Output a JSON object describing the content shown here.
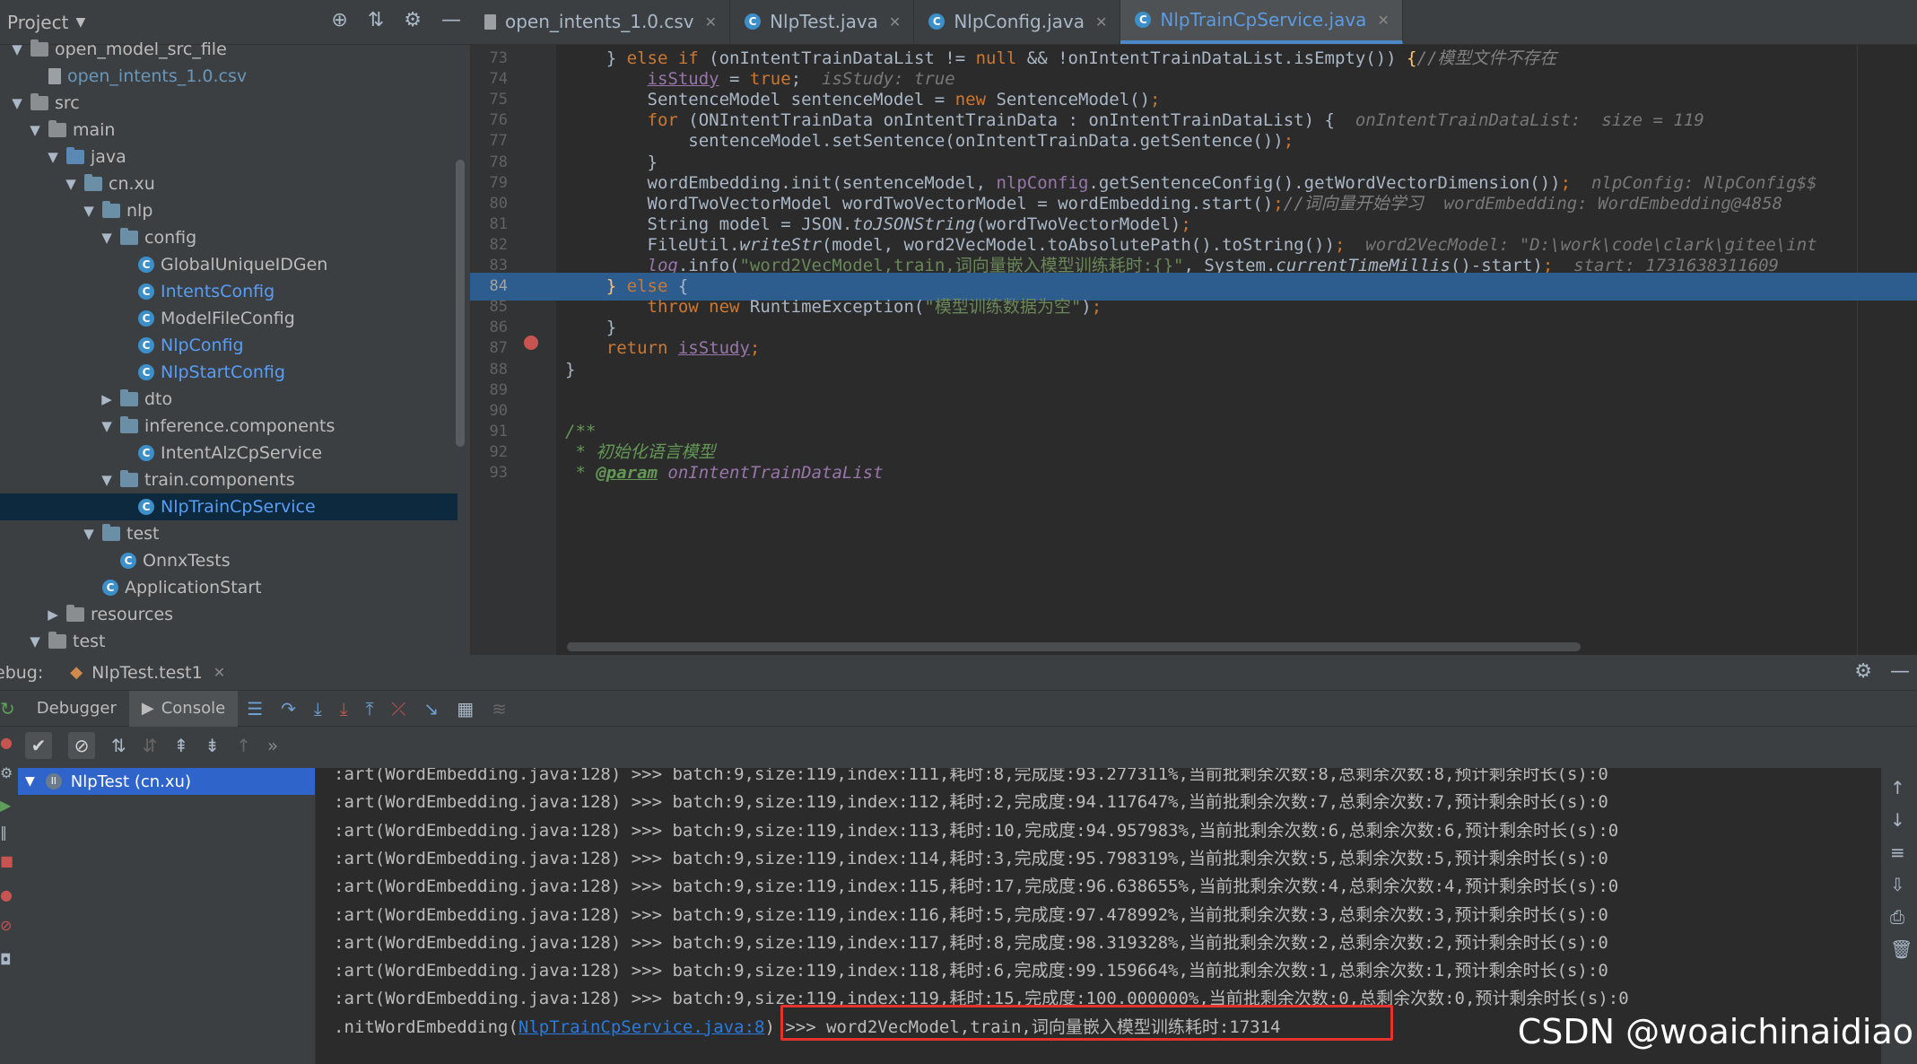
{
  "project": {
    "title": "Project",
    "tree": [
      {
        "label": "open_model_src_file",
        "depth": 0,
        "arrow": "▼",
        "icon": "folder",
        "color": "white"
      },
      {
        "label": "open_intents_1.0.csv",
        "depth": 1,
        "arrow": "",
        "icon": "file",
        "color": "blue"
      },
      {
        "label": "src",
        "depth": 0,
        "arrow": "▼",
        "icon": "folder",
        "color": "white"
      },
      {
        "label": "main",
        "depth": 1,
        "arrow": "▼",
        "icon": "folder",
        "color": "white"
      },
      {
        "label": "java",
        "depth": 2,
        "arrow": "▼",
        "icon": "src",
        "color": "white"
      },
      {
        "label": "cn.xu",
        "depth": 3,
        "arrow": "▼",
        "icon": "pkg",
        "color": "white"
      },
      {
        "label": "nlp",
        "depth": 4,
        "arrow": "▼",
        "icon": "pkg",
        "color": "white"
      },
      {
        "label": "config",
        "depth": 5,
        "arrow": "▼",
        "icon": "pkg",
        "color": "white"
      },
      {
        "label": "GlobalUniqueIDGen",
        "depth": 6,
        "arrow": "",
        "icon": "class",
        "color": "white"
      },
      {
        "label": "IntentsConfig",
        "depth": 6,
        "arrow": "",
        "icon": "class",
        "color": "link"
      },
      {
        "label": "ModelFileConfig",
        "depth": 6,
        "arrow": "",
        "icon": "class",
        "color": "white"
      },
      {
        "label": "NlpConfig",
        "depth": 6,
        "arrow": "",
        "icon": "class",
        "color": "link"
      },
      {
        "label": "NlpStartConfig",
        "depth": 6,
        "arrow": "",
        "icon": "class",
        "color": "link"
      },
      {
        "label": "dto",
        "depth": 5,
        "arrow": "▶",
        "icon": "pkg",
        "color": "white"
      },
      {
        "label": "inference.components",
        "depth": 5,
        "arrow": "▼",
        "icon": "pkg",
        "color": "white"
      },
      {
        "label": "IntentAlzCpService",
        "depth": 6,
        "arrow": "",
        "icon": "class",
        "color": "white"
      },
      {
        "label": "train.components",
        "depth": 5,
        "arrow": "▼",
        "icon": "pkg",
        "color": "white"
      },
      {
        "label": "NlpTrainCpService",
        "depth": 6,
        "arrow": "",
        "icon": "class",
        "color": "link",
        "selected": true
      },
      {
        "label": "test",
        "depth": 4,
        "arrow": "▼",
        "icon": "pkg",
        "color": "white"
      },
      {
        "label": "OnnxTests",
        "depth": 5,
        "arrow": "",
        "icon": "class",
        "color": "white"
      },
      {
        "label": "ApplicationStart",
        "depth": 4,
        "arrow": "",
        "icon": "class",
        "color": "white"
      },
      {
        "label": "resources",
        "depth": 2,
        "arrow": "▶",
        "icon": "folder",
        "color": "white"
      },
      {
        "label": "test",
        "depth": 1,
        "arrow": "▼",
        "icon": "folder",
        "color": "white"
      }
    ]
  },
  "tabs": [
    {
      "label": "open_intents_1.0.csv",
      "icon": "file",
      "active": false
    },
    {
      "label": "NlpTest.java",
      "icon": "class",
      "active": false
    },
    {
      "label": "NlpConfig.java",
      "icon": "class",
      "active": false
    },
    {
      "label": "NlpTrainCpService.java",
      "icon": "class",
      "active": true
    }
  ],
  "code_lines": [
    {
      "n": "73",
      "html": "    <span class='plain'>} </span><span class='k'>else if </span><span class='plain'>(onIntentTrainDataList != </span><span class='k'>null </span><span class='plain'>&amp;&amp; !onIntentTrainDataList.isEmpty()) </span><span class='fn'>{</span><span class='c'>//模型文件不存在</span>"
    },
    {
      "n": "74",
      "html": "        <span class='pf'><u>isStudy</u></span><span class='plain'> = </span><span class='k'>true</span><span class='plain'>;  </span><span class='hint'>isStudy: true</span>"
    },
    {
      "n": "75",
      "html": "        <span class='plain'>SentenceModel sentenceModel = </span><span class='k'>new </span><span class='plain'>SentenceModel()</span><span class='k'>;</span>"
    },
    {
      "n": "76",
      "html": "        <span class='k'>for </span><span class='plain'>(ONIntentTrainData onIntentTrainData : onIntentTrainDataList) {  </span><span class='hint'>onIntentTrainDataList:  size = 119</span>"
    },
    {
      "n": "77",
      "html": "            <span class='plain'>sentenceModel.setSentence(onIntentTrainData.getSentence())</span><span class='k'>;</span>"
    },
    {
      "n": "78",
      "html": "        <span class='plain'>}</span>"
    },
    {
      "n": "79",
      "html": "        <span class='plain'>wordEmbedding.init(sentenceModel, </span><span class='pf'>nlpConfig</span><span class='plain'>.getSentenceConfig().getWordVectorDimension())</span><span class='k'>;  </span><span class='hint'>nlpConfig: NlpConfig$$</span>"
    },
    {
      "n": "80",
      "html": "        <span class='plain'>WordTwoVectorModel wordTwoVectorModel = wordEmbedding.start()</span><span class='k'>;</span><span class='c'>//词向量开始学习  </span><span class='hint'>wordEmbedding: WordEmbedding@4858</span>"
    },
    {
      "n": "81",
      "html": "        <span class='plain'>String model = JSON.</span><span class='plain'><i>toJSONString</i></span><span class='plain'>(wordTwoVectorModel)</span><span class='k'>;</span>"
    },
    {
      "n": "82",
      "html": "        <span class='plain'>FileUtil.</span><span class='plain'><i>writeStr</i></span><span class='plain'>(model, word2VecModel.toAbsolutePath().toString())</span><span class='k'>;  </span><span class='hint'>word2VecModel: \"D:\\work\\code\\clark\\gitee\\int</span>"
    },
    {
      "n": "83",
      "html": "        <span class='pf'><i>log</i></span><span class='plain'>.info(</span><span class='s'>\"word2VecModel,train,词向量嵌入模型训练耗时:{}\"</span><span class='plain'>, System.</span><span class='plain'><i>currentTimeMillis</i></span><span class='plain'>()-start)</span><span class='k'>;  </span><span class='hint'>start: 1731638311609</span>"
    },
    {
      "n": "84",
      "html": "    <span class='fn'>}</span><span class='k'> else </span><span class='plain'>{</span>"
    },
    {
      "n": "85",
      "html": "        <span class='k'>throw new </span><span class='plain'>RuntimeException(</span><span class='s'>\"模型训练数据为空\"</span><span class='plain'>)</span><span class='k'>;</span>"
    },
    {
      "n": "86",
      "html": "    <span class='plain'>}</span>"
    },
    {
      "n": "87",
      "html": "    <span class='k'>return </span><span class='pf'><u>isStudy</u></span><span class='k'>;</span>"
    },
    {
      "n": "88",
      "html": "<span class='plain'>}</span>"
    },
    {
      "n": "89",
      "html": ""
    },
    {
      "n": "90",
      "html": ""
    },
    {
      "n": "91",
      "html": "<span class='doc'>/**</span>"
    },
    {
      "n": "92",
      "html": " <span class='doc'>* 初始化语言模型</span>"
    },
    {
      "n": "93",
      "html": " <span class='doc'>* </span><span class='doc'><b><u>@param</u></b></span><span class='pf'><i> onIntentTrainDataList</i></span>"
    }
  ],
  "debug": {
    "label": "ebug:",
    "session": "NlpTest.test1",
    "tabs": [
      "Debugger",
      "Console"
    ],
    "frame": "NlpTest (cn.xu)"
  },
  "console_lines": [
    ":art(WordEmbedding.java:128) >>> batch:9,size:119,index:111,耗时:8,完成度:93.277311%,当前批剩余次数:8,总剩余次数:8,预计剩余时长(s):0",
    ":art(WordEmbedding.java:128) >>> batch:9,size:119,index:112,耗时:2,完成度:94.117647%,当前批剩余次数:7,总剩余次数:7,预计剩余时长(s):0",
    ":art(WordEmbedding.java:128) >>> batch:9,size:119,index:113,耗时:10,完成度:94.957983%,当前批剩余次数:6,总剩余次数:6,预计剩余时长(s):0",
    ":art(WordEmbedding.java:128) >>> batch:9,size:119,index:114,耗时:3,完成度:95.798319%,当前批剩余次数:5,总剩余次数:5,预计剩余时长(s):0",
    ":art(WordEmbedding.java:128) >>> batch:9,size:119,index:115,耗时:17,完成度:96.638655%,当前批剩余次数:4,总剩余次数:4,预计剩余时长(s):0",
    ":art(WordEmbedding.java:128) >>> batch:9,size:119,index:116,耗时:5,完成度:97.478992%,当前批剩余次数:3,总剩余次数:3,预计剩余时长(s):0",
    ":art(WordEmbedding.java:128) >>> batch:9,size:119,index:117,耗时:8,完成度:98.319328%,当前批剩余次数:2,总剩余次数:2,预计剩余时长(s):0",
    ":art(WordEmbedding.java:128) >>> batch:9,size:119,index:118,耗时:6,完成度:99.159664%,当前批剩余次数:1,总剩余次数:1,预计剩余时长(s):0",
    ":art(WordEmbedding.java:128) >>> batch:9,size:119,index:119,耗时:15,完成度:100.000000%,当前批剩余次数:0,总剩余次数:0,预计剩余时长(s):0"
  ],
  "console_last": {
    "prefix": ".nitWordEmbedding(",
    "link": "NlpTrainCpService.java:8",
    "suffix": ") >>> word2VecModel,train,词向量嵌入模型训练耗时:17314"
  },
  "watermark": "CSDN @woaichinaidiao"
}
